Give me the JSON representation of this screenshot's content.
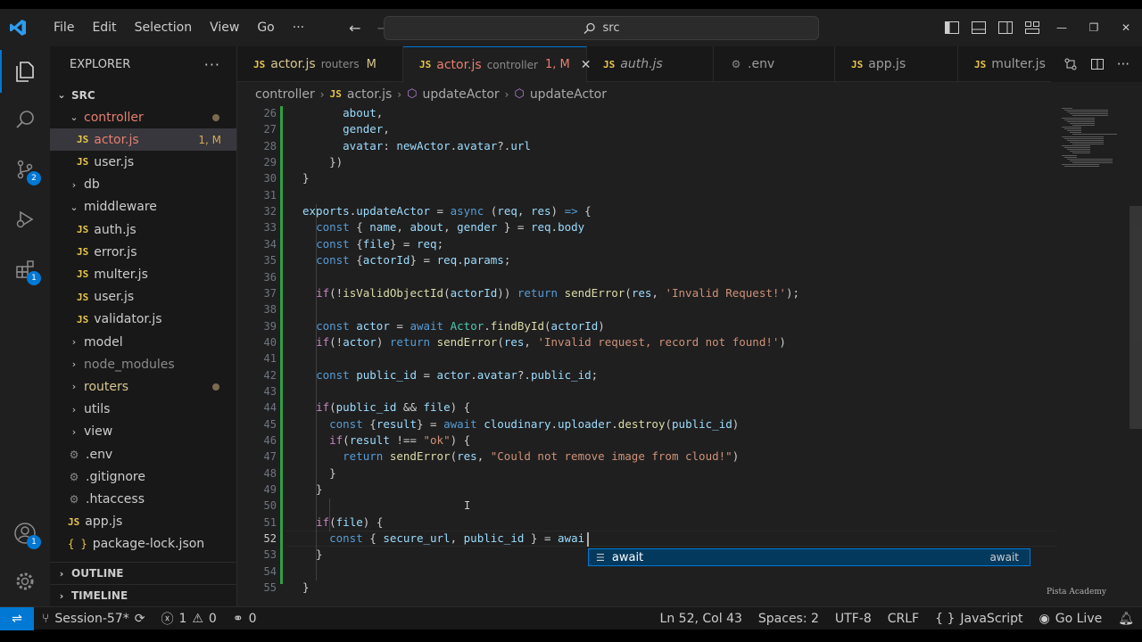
{
  "menu": [
    "File",
    "Edit",
    "Selection",
    "View",
    "Go",
    "···"
  ],
  "search": {
    "text": "src"
  },
  "explorer": {
    "title": "EXPLORER",
    "root": "SRC",
    "tree": [
      {
        "label": "controller",
        "kind": "folder-open",
        "indent": 1,
        "dot": true,
        "color": "#e57f6f"
      },
      {
        "label": "actor.js",
        "kind": "js",
        "indent": 2,
        "badge": "1, M",
        "selected": true,
        "color": "#e57f6f"
      },
      {
        "label": "user.js",
        "kind": "js",
        "indent": 2
      },
      {
        "label": "db",
        "kind": "folder",
        "indent": 1
      },
      {
        "label": "middleware",
        "kind": "folder-open",
        "indent": 1
      },
      {
        "label": "auth.js",
        "kind": "js",
        "indent": 2
      },
      {
        "label": "error.js",
        "kind": "js",
        "indent": 2
      },
      {
        "label": "multer.js",
        "kind": "js",
        "indent": 2
      },
      {
        "label": "user.js",
        "kind": "js",
        "indent": 2
      },
      {
        "label": "validator.js",
        "kind": "js",
        "indent": 2
      },
      {
        "label": "model",
        "kind": "folder",
        "indent": 1
      },
      {
        "label": "node_modules",
        "kind": "folder",
        "indent": 1,
        "color": "#8a8a8a"
      },
      {
        "label": "routers",
        "kind": "folder",
        "indent": 1,
        "dot": true,
        "color": "#d7c690"
      },
      {
        "label": "utils",
        "kind": "folder",
        "indent": 1
      },
      {
        "label": "view",
        "kind": "folder",
        "indent": 1
      },
      {
        "label": ".env",
        "kind": "gear",
        "indent": 1
      },
      {
        "label": ".gitignore",
        "kind": "gear",
        "indent": 1
      },
      {
        "label": ".htaccess",
        "kind": "gear",
        "indent": 1
      },
      {
        "label": "app.js",
        "kind": "js",
        "indent": 1
      },
      {
        "label": "package-lock.json",
        "kind": "json",
        "indent": 1
      }
    ],
    "outline": "OUTLINE",
    "timeline": "TIMELINE"
  },
  "tabs": [
    {
      "lang": "JS",
      "name": "actor.js",
      "desc": "routers",
      "mod": "M",
      "color": "#d7c690"
    },
    {
      "lang": "JS",
      "name": "actor.js",
      "desc": "controller",
      "mod": "1, M",
      "active": true,
      "color": "#e57f6f"
    },
    {
      "lang": "JS",
      "name": "auth.js",
      "italic": true
    },
    {
      "lang": "gear",
      "name": ".env"
    },
    {
      "lang": "JS",
      "name": "app.js"
    },
    {
      "lang": "JS",
      "name": "multer.js"
    }
  ],
  "breadcrumb": [
    "controller",
    "actor.js",
    "updateActor",
    "updateActor"
  ],
  "editor": {
    "first_line": 26,
    "current_line": 52,
    "lines": [
      "      about,",
      "      gender,",
      "      avatar: newActor.avatar?.url",
      "    })",
      "}",
      "",
      "exports.updateActor = async (req, res) => {",
      "  const { name, about, gender } = req.body",
      "  const {file} = req;",
      "  const {actorId} = req.params;",
      "",
      "  if(!isValidObjectId(actorId)) return sendError(res, 'Invalid Request!');",
      "",
      "  const actor = await Actor.findById(actorId)",
      "  if(!actor) return sendError(res, 'Invalid request, record not found!')",
      "",
      "  const public_id = actor.avatar?.public_id;",
      "",
      "  if(public_id && file) {",
      "    const {result} = await cloudinary.uploader.destroy(public_id)",
      "    if(result !== \"ok\") {",
      "      return sendError(res, \"Could not remove image from cloud!\")",
      "    }",
      "  }",
      "",
      "  if(file) {",
      "    const { secure_url, public_id } = awai",
      "  }",
      "",
      "}"
    ]
  },
  "suggest": {
    "label": "await",
    "detail": "await"
  },
  "watermark": "Pista Academy",
  "status": {
    "branch": "Session-57*",
    "errors": "1",
    "warnings": "0",
    "ports": "0",
    "position": "Ln 52, Col 43",
    "spaces": "Spaces: 2",
    "encoding": "UTF-8",
    "eol": "CRLF",
    "language": "JavaScript",
    "golive": "Go Live"
  },
  "activity_badges": {
    "scm": "2",
    "extensions": "1",
    "accounts": "1"
  }
}
